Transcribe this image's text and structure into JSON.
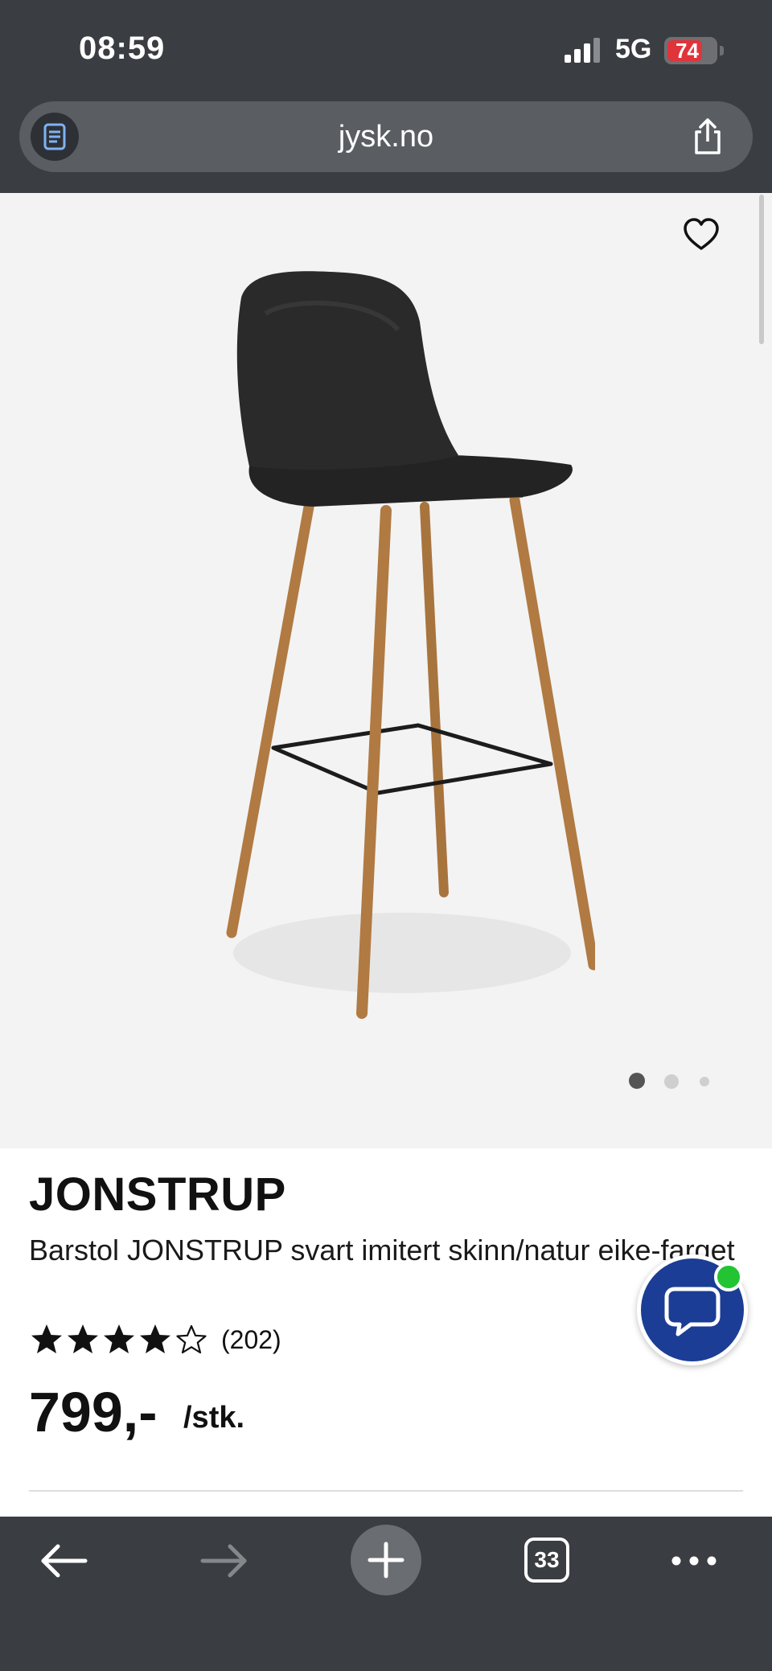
{
  "status_bar": {
    "time": "08:59",
    "network": "5G",
    "battery": "74",
    "battery_level": 0.74
  },
  "browser": {
    "url": "jysk.no",
    "tabs_count": "33"
  },
  "product": {
    "name": "JONSTRUP",
    "description": "Barstol JONSTRUP svart imitert skinn/natur eike-farget",
    "rating": 4,
    "rating_max": 5,
    "reviews": "(202)",
    "price": "799,-",
    "unit": "/stk."
  },
  "gallery": {
    "images": 3,
    "active_index": 0
  },
  "icons": {
    "reader": "reader-icon",
    "share": "share-icon",
    "favorite": "heart-icon",
    "chat": "chat-bubble-icon",
    "back": "arrow-left-icon",
    "forward": "arrow-right-icon",
    "new_tab": "plus-icon",
    "more": "more-dots-icon"
  },
  "colors": {
    "chrome": "#3a3d41",
    "chat": "#1b3d95",
    "online": "#22c433",
    "battery": "#e0343b"
  }
}
